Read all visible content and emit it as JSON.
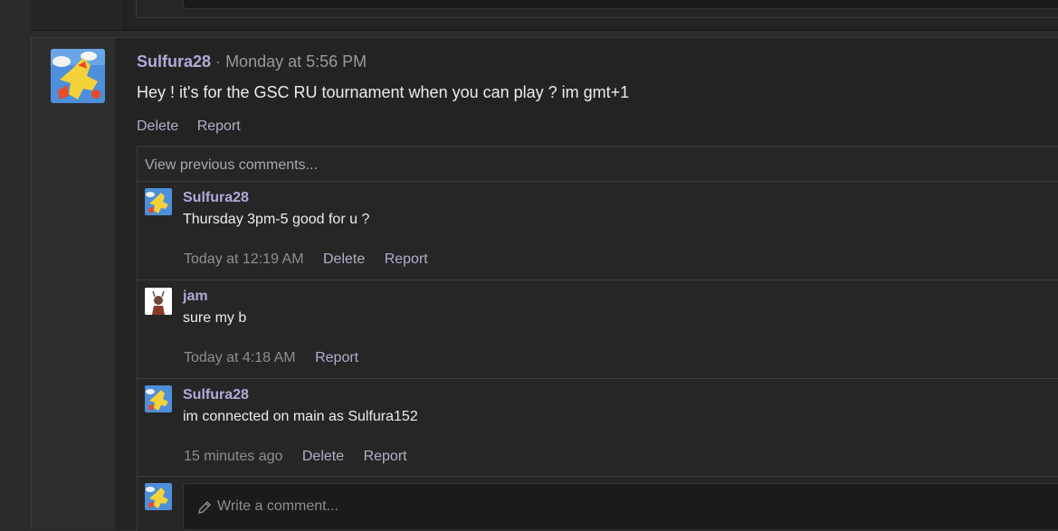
{
  "post": {
    "author": "Sulfura28",
    "separator": "·",
    "timestamp": "Monday at 5:56 PM",
    "text": "Hey ! it's for the GSC RU tournament when you can play ? im gmt+1",
    "actions": {
      "delete": "Delete",
      "report": "Report"
    }
  },
  "comments": {
    "view_previous": "View previous comments...",
    "items": [
      {
        "author": "Sulfura28",
        "text": "Thursday 3pm-5 good for u ?",
        "time": "Today at 12:19 AM",
        "delete": "Delete",
        "report": "Report"
      },
      {
        "author": "jam",
        "text": "sure my b",
        "time": "Today at 4:18 AM",
        "report": "Report"
      },
      {
        "author": "Sulfura28",
        "text": "im connected on main as Sulfura152",
        "time": "15 minutes ago",
        "delete": "Delete",
        "report": "Report"
      }
    ],
    "compose": {
      "placeholder": "Write a comment..."
    }
  },
  "colors": {
    "username": "#b4a8d8",
    "background": "#232323",
    "link": "#b0b0c8"
  },
  "icons": {
    "compose": "pencil-icon"
  }
}
